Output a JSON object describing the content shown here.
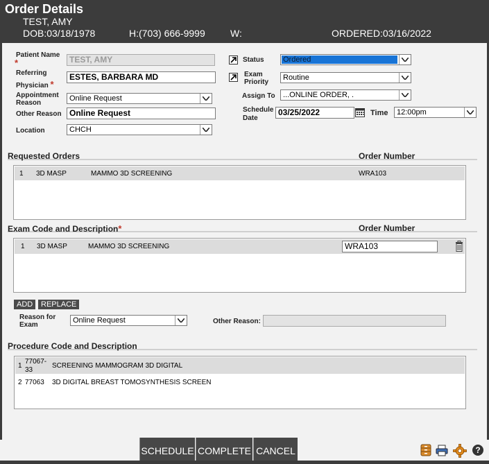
{
  "header": {
    "title": "Order Details",
    "patient_name": "TEST, AMY",
    "dob": "DOB:03/18/1978",
    "home_phone": "H:(703) 666-9999",
    "work_phone": "W:",
    "ordered": "ORDERED:03/16/2022"
  },
  "form": {
    "patient_name_label": "Patient  Name",
    "patient_name_value": "TEST, AMY",
    "referring_label_1": "Referring",
    "referring_label_2": "Physician",
    "referring_value": "ESTES, BARBARA MD",
    "appt_reason_label_1": "Appointment",
    "appt_reason_label_2": "Reason",
    "appt_reason_value": "Online Request",
    "other_reason_label": "Other Reason",
    "other_reason_value": "Online Request",
    "location_label": "Location",
    "location_value": "CHCH",
    "status_label": "Status",
    "status_value": "Ordered",
    "exam_priority_label_1": "Exam",
    "exam_priority_label_2": "Priority",
    "exam_priority_value": "Routine",
    "assign_to_label": "Assign To",
    "assign_to_value": "...ONLINE ORDER, .",
    "schedule_date_label_1": "Schedule",
    "schedule_date_label_2": "Date",
    "schedule_date_value": "03/25/2022",
    "time_label": "Time",
    "time_value": "12:00pm",
    "required_mark": "*"
  },
  "requested_orders": {
    "title": "Requested Orders",
    "order_number_header": "Order Number",
    "rows": [
      {
        "num": "1",
        "code": "3D MASP",
        "desc": "MAMMO 3D SCREENING",
        "order": "WRA103"
      }
    ]
  },
  "exam_codes": {
    "title": "Exam Code and Description",
    "order_number_header": "Order Number",
    "rows": [
      {
        "num": "1",
        "code": "3D MASP",
        "desc": "MAMMO 3D SCREENING",
        "order": "WRA103"
      }
    ],
    "add_label": "ADD",
    "replace_label": "REPLACE",
    "reason_label_1": "Reason for",
    "reason_label_2": "Exam",
    "reason_value": "Online Request",
    "other_reason_label": "Other Reason:",
    "other_reason_value": ""
  },
  "procedure_codes": {
    "title": "Procedure Code and Description",
    "rows": [
      {
        "num": "1",
        "code_1": "77067-",
        "code_2": "33",
        "desc": "SCREENING MAMMOGRAM 3D DIGITAL"
      },
      {
        "num": "2",
        "code": "77063",
        "desc": "3D DIGITAL BREAST TOMOSYNTHESIS SCREEN"
      }
    ]
  },
  "footer": {
    "schedule_label": "SCHEDULE",
    "complete_label": "COMPLETE",
    "cancel_label": "CANCEL",
    "help_glyph": "?"
  },
  "colors": {
    "header_bg": "#3c3c3c",
    "panel_bg": "#f2f2f2",
    "status_highlight": "#1874d6",
    "required": "#c0392b"
  }
}
